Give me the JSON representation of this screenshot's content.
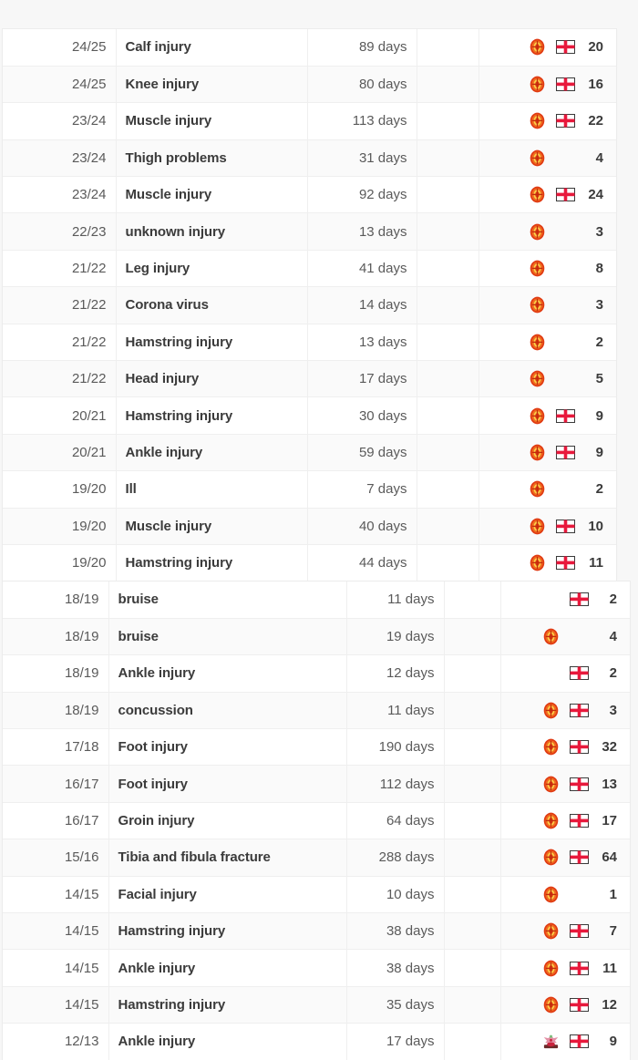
{
  "page": {
    "background": "#f7f7f7",
    "card_background": "#ffffff",
    "row_alt_background": "#fafafa",
    "border_color": "#efefef",
    "text_color": "#4a4a4a",
    "bold_text_color": "#3b3b3b",
    "accent_red": "#da291c"
  },
  "tables": [
    {
      "name": "injury-history-upper",
      "rows": [
        {
          "season": "24/25",
          "injury": "Calf injury",
          "days": "89 days",
          "crest": "man-utd-crest",
          "flag": "england-flag",
          "games": "20"
        },
        {
          "season": "24/25",
          "injury": "Knee injury",
          "days": "80 days",
          "crest": "man-utd-crest",
          "flag": "england-flag",
          "games": "16"
        },
        {
          "season": "23/24",
          "injury": "Muscle injury",
          "days": "113 days",
          "crest": "man-utd-crest",
          "flag": "england-flag",
          "games": "22"
        },
        {
          "season": "23/24",
          "injury": "Thigh problems",
          "days": "31 days",
          "crest": "man-utd-crest",
          "flag": "",
          "games": "4"
        },
        {
          "season": "23/24",
          "injury": "Muscle injury",
          "days": "92 days",
          "crest": "man-utd-crest",
          "flag": "england-flag",
          "games": "24"
        },
        {
          "season": "22/23",
          "injury": "unknown injury",
          "days": "13 days",
          "crest": "man-utd-crest",
          "flag": "",
          "games": "3"
        },
        {
          "season": "21/22",
          "injury": "Leg injury",
          "days": "41 days",
          "crest": "man-utd-crest",
          "flag": "",
          "games": "8"
        },
        {
          "season": "21/22",
          "injury": "Corona virus",
          "days": "14 days",
          "crest": "man-utd-crest",
          "flag": "",
          "games": "3"
        },
        {
          "season": "21/22",
          "injury": "Hamstring injury",
          "days": "13 days",
          "crest": "man-utd-crest",
          "flag": "",
          "games": "2"
        },
        {
          "season": "21/22",
          "injury": "Head injury",
          "days": "17 days",
          "crest": "man-utd-crest",
          "flag": "",
          "games": "5"
        },
        {
          "season": "20/21",
          "injury": "Hamstring injury",
          "days": "30 days",
          "crest": "man-utd-crest",
          "flag": "england-flag",
          "games": "9"
        },
        {
          "season": "20/21",
          "injury": "Ankle injury",
          "days": "59 days",
          "crest": "man-utd-crest",
          "flag": "england-flag",
          "games": "9"
        },
        {
          "season": "19/20",
          "injury": "Ill",
          "days": "7 days",
          "crest": "man-utd-crest",
          "flag": "",
          "games": "2"
        },
        {
          "season": "19/20",
          "injury": "Muscle injury",
          "days": "40 days",
          "crest": "man-utd-crest",
          "flag": "england-flag",
          "games": "10"
        },
        {
          "season": "19/20",
          "injury": "Hamstring injury",
          "days": "44 days",
          "crest": "man-utd-crest",
          "flag": "england-flag",
          "games": "11"
        }
      ]
    },
    {
      "name": "injury-history-lower",
      "rows": [
        {
          "season": "18/19",
          "injury": "bruise",
          "days": "11 days",
          "crest": "",
          "flag": "england-flag",
          "games": "2"
        },
        {
          "season": "18/19",
          "injury": "bruise",
          "days": "19 days",
          "crest": "man-utd-crest",
          "flag": "",
          "games": "4"
        },
        {
          "season": "18/19",
          "injury": "Ankle injury",
          "days": "12 days",
          "crest": "",
          "flag": "england-flag",
          "games": "2"
        },
        {
          "season": "18/19",
          "injury": "concussion",
          "days": "11 days",
          "crest": "man-utd-crest",
          "flag": "england-flag",
          "games": "3"
        },
        {
          "season": "17/18",
          "injury": "Foot injury",
          "days": "190 days",
          "crest": "man-utd-crest",
          "flag": "england-flag",
          "games": "32"
        },
        {
          "season": "16/17",
          "injury": "Foot injury",
          "days": "112 days",
          "crest": "man-utd-crest",
          "flag": "england-flag",
          "games": "13"
        },
        {
          "season": "16/17",
          "injury": "Groin injury",
          "days": "64 days",
          "crest": "man-utd-crest",
          "flag": "england-flag",
          "games": "17"
        },
        {
          "season": "15/16",
          "injury": "Tibia and fibula fracture",
          "days": "288 days",
          "crest": "man-utd-crest",
          "flag": "england-flag",
          "games": "64"
        },
        {
          "season": "14/15",
          "injury": "Facial injury",
          "days": "10 days",
          "crest": "man-utd-crest",
          "flag": "",
          "games": "1"
        },
        {
          "season": "14/15",
          "injury": "Hamstring injury",
          "days": "38 days",
          "crest": "man-utd-crest",
          "flag": "england-flag",
          "games": "7"
        },
        {
          "season": "14/15",
          "injury": "Ankle injury",
          "days": "38 days",
          "crest": "man-utd-crest",
          "flag": "england-flag",
          "games": "11"
        },
        {
          "season": "14/15",
          "injury": "Hamstring injury",
          "days": "35 days",
          "crest": "man-utd-crest",
          "flag": "england-flag",
          "games": "12"
        },
        {
          "season": "12/13",
          "injury": "Ankle injury",
          "days": "17 days",
          "crest": "crystal-palace-crest",
          "flag": "england-flag",
          "games": "9"
        }
      ]
    }
  ]
}
